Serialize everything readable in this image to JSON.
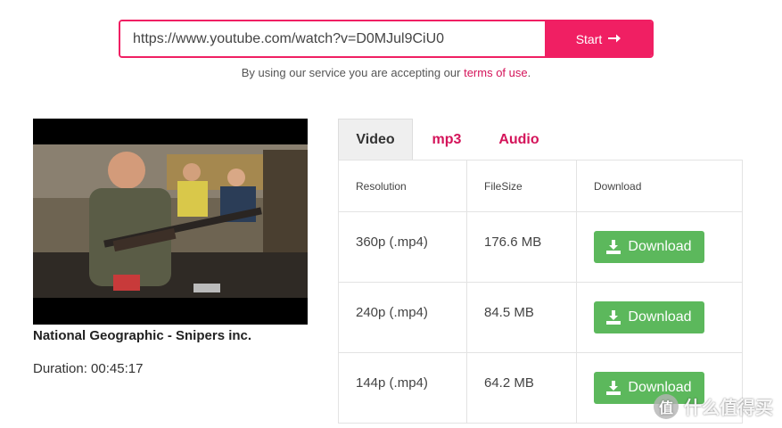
{
  "search": {
    "url_value": "https://www.youtube.com/watch?v=D0MJul9CiU0",
    "start_label": "Start",
    "start_icon": "arrow-right-icon"
  },
  "terms": {
    "prefix": "By using our service you are accepting our ",
    "link": "terms of use",
    "suffix": "."
  },
  "video": {
    "title": "National Geographic - Snipers inc.",
    "duration": "Duration: 00:45:17"
  },
  "tabs": [
    {
      "label": "Video",
      "active": true
    },
    {
      "label": "mp3",
      "active": false
    },
    {
      "label": "Audio",
      "active": false
    }
  ],
  "table": {
    "headers": [
      "Resolution",
      "FileSize",
      "Download"
    ],
    "rows": [
      {
        "resolution": "360p (.mp4)",
        "filesize": "176.6 MB",
        "download": "Download"
      },
      {
        "resolution": "240p (.mp4)",
        "filesize": "84.5 MB",
        "download": "Download"
      },
      {
        "resolution": "144p (.mp4)",
        "filesize": "64.2 MB",
        "download": "Download"
      }
    ]
  },
  "watermark": {
    "badge": "值",
    "text": "什么值得买"
  },
  "colors": {
    "accent": "#f01f63",
    "link": "#d4145a",
    "download_button": "#5cb85c"
  }
}
